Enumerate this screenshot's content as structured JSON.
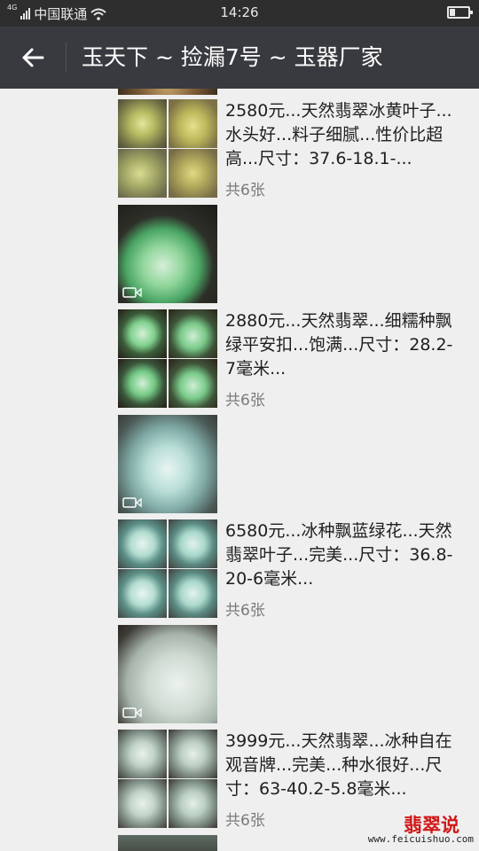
{
  "status_bar": {
    "network_label": "4G",
    "carrier": "中国联通",
    "time": "14:26",
    "wifi_icon": "wifi-icon",
    "battery_icon": "battery-icon"
  },
  "header": {
    "back_icon": "back-arrow-icon",
    "title": "玉天下 ~ 捡漏7号 ~ 玉器厂家"
  },
  "posts": [
    {
      "type": "image-grid",
      "text": "2580元...天然翡翠冰黄叶子...水头好...料子细腻...性价比超高...尺寸：37.6-18.1-...",
      "count": "共6张"
    },
    {
      "type": "video",
      "icon": "video-icon"
    },
    {
      "type": "image-grid",
      "text": "2880元...天然翡翠...细糯种飘绿平安扣...饱满...尺寸：28.2-7毫米...",
      "count": "共6张"
    },
    {
      "type": "video",
      "icon": "video-icon"
    },
    {
      "type": "image-grid",
      "text": "6580元...冰种飘蓝绿花...天然翡翠叶子...完美...尺寸：36.8-20-6毫米...",
      "count": "共6张"
    },
    {
      "type": "video",
      "icon": "video-icon"
    },
    {
      "type": "image-grid",
      "text": "3999元...天然翡翠...冰种自在观音牌...完美...种水很好...尺寸：63-40.2-5.8毫米...",
      "count": "共6张"
    }
  ],
  "watermark": {
    "logo": "翡翠说",
    "url": "www.feicuishuo.com"
  },
  "colors": {
    "status_bar": "#2e2e2e",
    "title_bar": "#393a3f",
    "feed_background": "#efefef",
    "count_text": "#7a7a7a",
    "watermark_red": "#d01919"
  }
}
